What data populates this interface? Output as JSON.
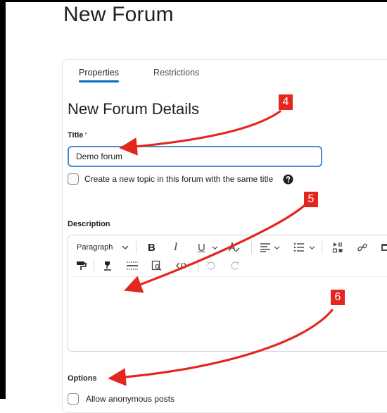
{
  "page": {
    "title": "New Forum"
  },
  "tabs": [
    {
      "label": "Properties",
      "active": true
    },
    {
      "label": "Restrictions",
      "active": false
    }
  ],
  "section": {
    "title": "New Forum Details"
  },
  "title_field": {
    "label": "Title",
    "required_marker": "*",
    "value": "Demo forum"
  },
  "same_title_checkbox": {
    "label": "Create a new topic in this forum with the same title",
    "checked": false,
    "help_icon": "question-circle-icon"
  },
  "description": {
    "label": "Description",
    "toolbar": {
      "block_format": "Paragraph",
      "icons_row1": [
        "chevron-down-icon",
        "bold-icon",
        "italic-icon",
        "underline-icon",
        "chevron-down-icon",
        "text-color-icon",
        "chevron-down-icon",
        "align-icon",
        "chevron-down-icon",
        "list-icon",
        "chevron-down-icon",
        "insert-media-icon",
        "link-icon",
        "image-icon"
      ],
      "icons_row2": [
        "format-painter-icon",
        "highlight-icon",
        "horizontal-rule-icon",
        "find-replace-icon",
        "source-code-icon",
        "undo-icon",
        "redo-icon"
      ],
      "bold_glyph": "B",
      "italic_glyph": "I",
      "underline_glyph": "U"
    }
  },
  "options": {
    "label": "Options",
    "partial_checkbox_label": "Allow anonymous posts"
  },
  "annotations": [
    {
      "number": "4"
    },
    {
      "number": "5"
    },
    {
      "number": "6"
    }
  ],
  "colors": {
    "accent": "#006fbf",
    "focus_border": "#4a8bd1",
    "annotation_red": "#e5261f"
  }
}
